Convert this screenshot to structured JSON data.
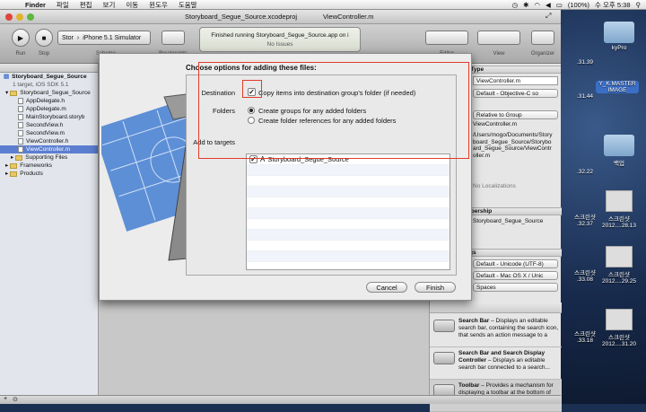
{
  "menubar": {
    "app": "Finder",
    "items": [
      "파일",
      "편집",
      "보기",
      "이동",
      "윈도우",
      "도움말"
    ],
    "battery": "(100%)",
    "clock": "수 오후 5:38"
  },
  "window": {
    "tabs": [
      {
        "label": "Storyboard_Segue_Source.xcodeproj"
      },
      {
        "label": "ViewController.m"
      }
    ]
  },
  "toolbar": {
    "run_label": "Run",
    "stop_label": "Stop",
    "scheme_target": "Stor",
    "scheme_device": "iPhone 5.1 Simulator",
    "scheme_caption": "Scheme",
    "breakpoints_label": "Breakpoints",
    "activity_line1": "Finished running Storyboard_Segue_Source.app on i",
    "activity_line2": "No Issues",
    "editor_label": "Editor",
    "view_label": "View",
    "organizer_label": "Organizer"
  },
  "navigator": {
    "project": "Storyboard_Segue_Source",
    "project_sub": "1 target, iOS SDK 5.1",
    "group": "Storyboard_Segue_Source",
    "files": [
      "AppDelegate.h",
      "AppDelegate.m",
      "MainStoryboard.storyb",
      "SecondView.h",
      "SecondView.m",
      "ViewController.h",
      "ViewController.m"
    ],
    "selected_file": "ViewController.m",
    "folders": [
      "Supporting Files",
      "Frameworks",
      "Products"
    ]
  },
  "dialog": {
    "title": "Choose options for adding these files:",
    "destination_label": "Destination",
    "copy_items_label": "Copy items into destination group's folder (if needed)",
    "copy_checked": "✓",
    "folders_label": "Folders",
    "folder_option_1": "Create groups for any added folders",
    "folder_option_2": "Create folder references for any added folders",
    "targets_label": "Add to targets",
    "target_name": "Storyboard_Segue_Source",
    "target_checked": "✓",
    "cancel_label": "Cancel",
    "finish_label": "Finish"
  },
  "utilities": {
    "file_type_header": "e Type",
    "file_name": "ViewController.m",
    "file_type_value": "Default - Objective-C so",
    "location_value": "Relative to Group",
    "relative_path": "ViewController.m",
    "full_path": "/Users/mogo/Documents/Storyboard_Segue_Source/Storyboard_Segue_Source/ViewController.m",
    "no_localizations": "No Localizations",
    "membership_header": "mbership",
    "membership_target": "Storyboard_Segue_Source",
    "text_settings_header": "ngs",
    "encoding_value": "Default - Unicode (UTF-8)",
    "line_endings_value": "Default - Mac OS X / Unic",
    "indent_value": "Spaces",
    "library": [
      {
        "title": "Search Bar",
        "desc": " – Displays an editable search bar, containing the search icon, that sends an action message to a"
      },
      {
        "title": "Search Bar and Search Display Controller",
        "desc": " – Displays an editable search bar connected to a search..."
      },
      {
        "title": "Toolbar",
        "desc": " – Provides a mechanism for displaying a toolbar at the bottom of the screen."
      }
    ]
  },
  "desktop": {
    "icons": [
      {
        "caption": ".31.39"
      },
      {
        "caption": "kyPro"
      },
      {
        "caption": ".31.44"
      },
      {
        "caption": "Y_K MASTER IMAGE"
      },
      {
        "caption": "백업"
      },
      {
        "caption": ".32.22"
      },
      {
        "caption": "스크린샷"
      },
      {
        "caption": ".32.37"
      },
      {
        "caption": "스크린샷 2012....28.13"
      },
      {
        "caption": "스크린샷"
      },
      {
        "caption": ".33.08"
      },
      {
        "caption": "스크린샷 2012....29.25"
      },
      {
        "caption": "스크린샷"
      },
      {
        "caption": ".33.18"
      },
      {
        "caption": "스크린샷 2012....31.20"
      }
    ]
  }
}
